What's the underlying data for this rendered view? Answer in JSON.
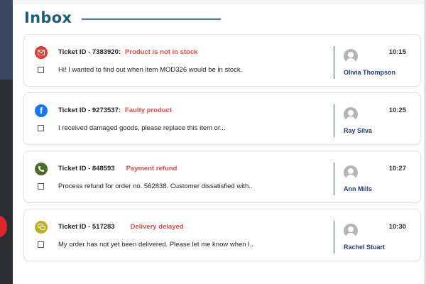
{
  "header": {
    "title": "Inbox"
  },
  "tickets": [
    {
      "channel_icon": "mail-icon",
      "channel_color": "#e53935",
      "id_label": "Ticket ID - ",
      "id": "7383920:",
      "subject": "Product is not in stock",
      "message": "Hi! I wanted to find out when item MOD326  would be in stock.",
      "agent": "Olivia Thompson",
      "time": "10:15"
    },
    {
      "channel_icon": "facebook-icon",
      "channel_color": "#1877f2",
      "id_label": "Ticket ID - ",
      "id": "9273537:",
      "subject": "Faulty product",
      "message": " I received damaged goods, please replace this item or...",
      "agent": "Ray Silva",
      "time": "10:25"
    },
    {
      "channel_icon": "phone-icon",
      "channel_color": "#4e6b2e",
      "id_label": "Ticket ID - ",
      "id": "848593",
      "subject": "Payment refund",
      "message": "Process refund for order no. 562838. Customer dissatisfied with..",
      "agent": "Ann Mills",
      "time": "10:27"
    },
    {
      "channel_icon": "chat-icon",
      "channel_color": "#b9b21e",
      "id_label": "Ticket ID - ",
      "id": "517283",
      "subject": "Delivery delayed",
      "message": "My order has not yet been delivered. Please let me know when I..",
      "agent": "Rachel Stuart",
      "time": "10:30"
    }
  ]
}
